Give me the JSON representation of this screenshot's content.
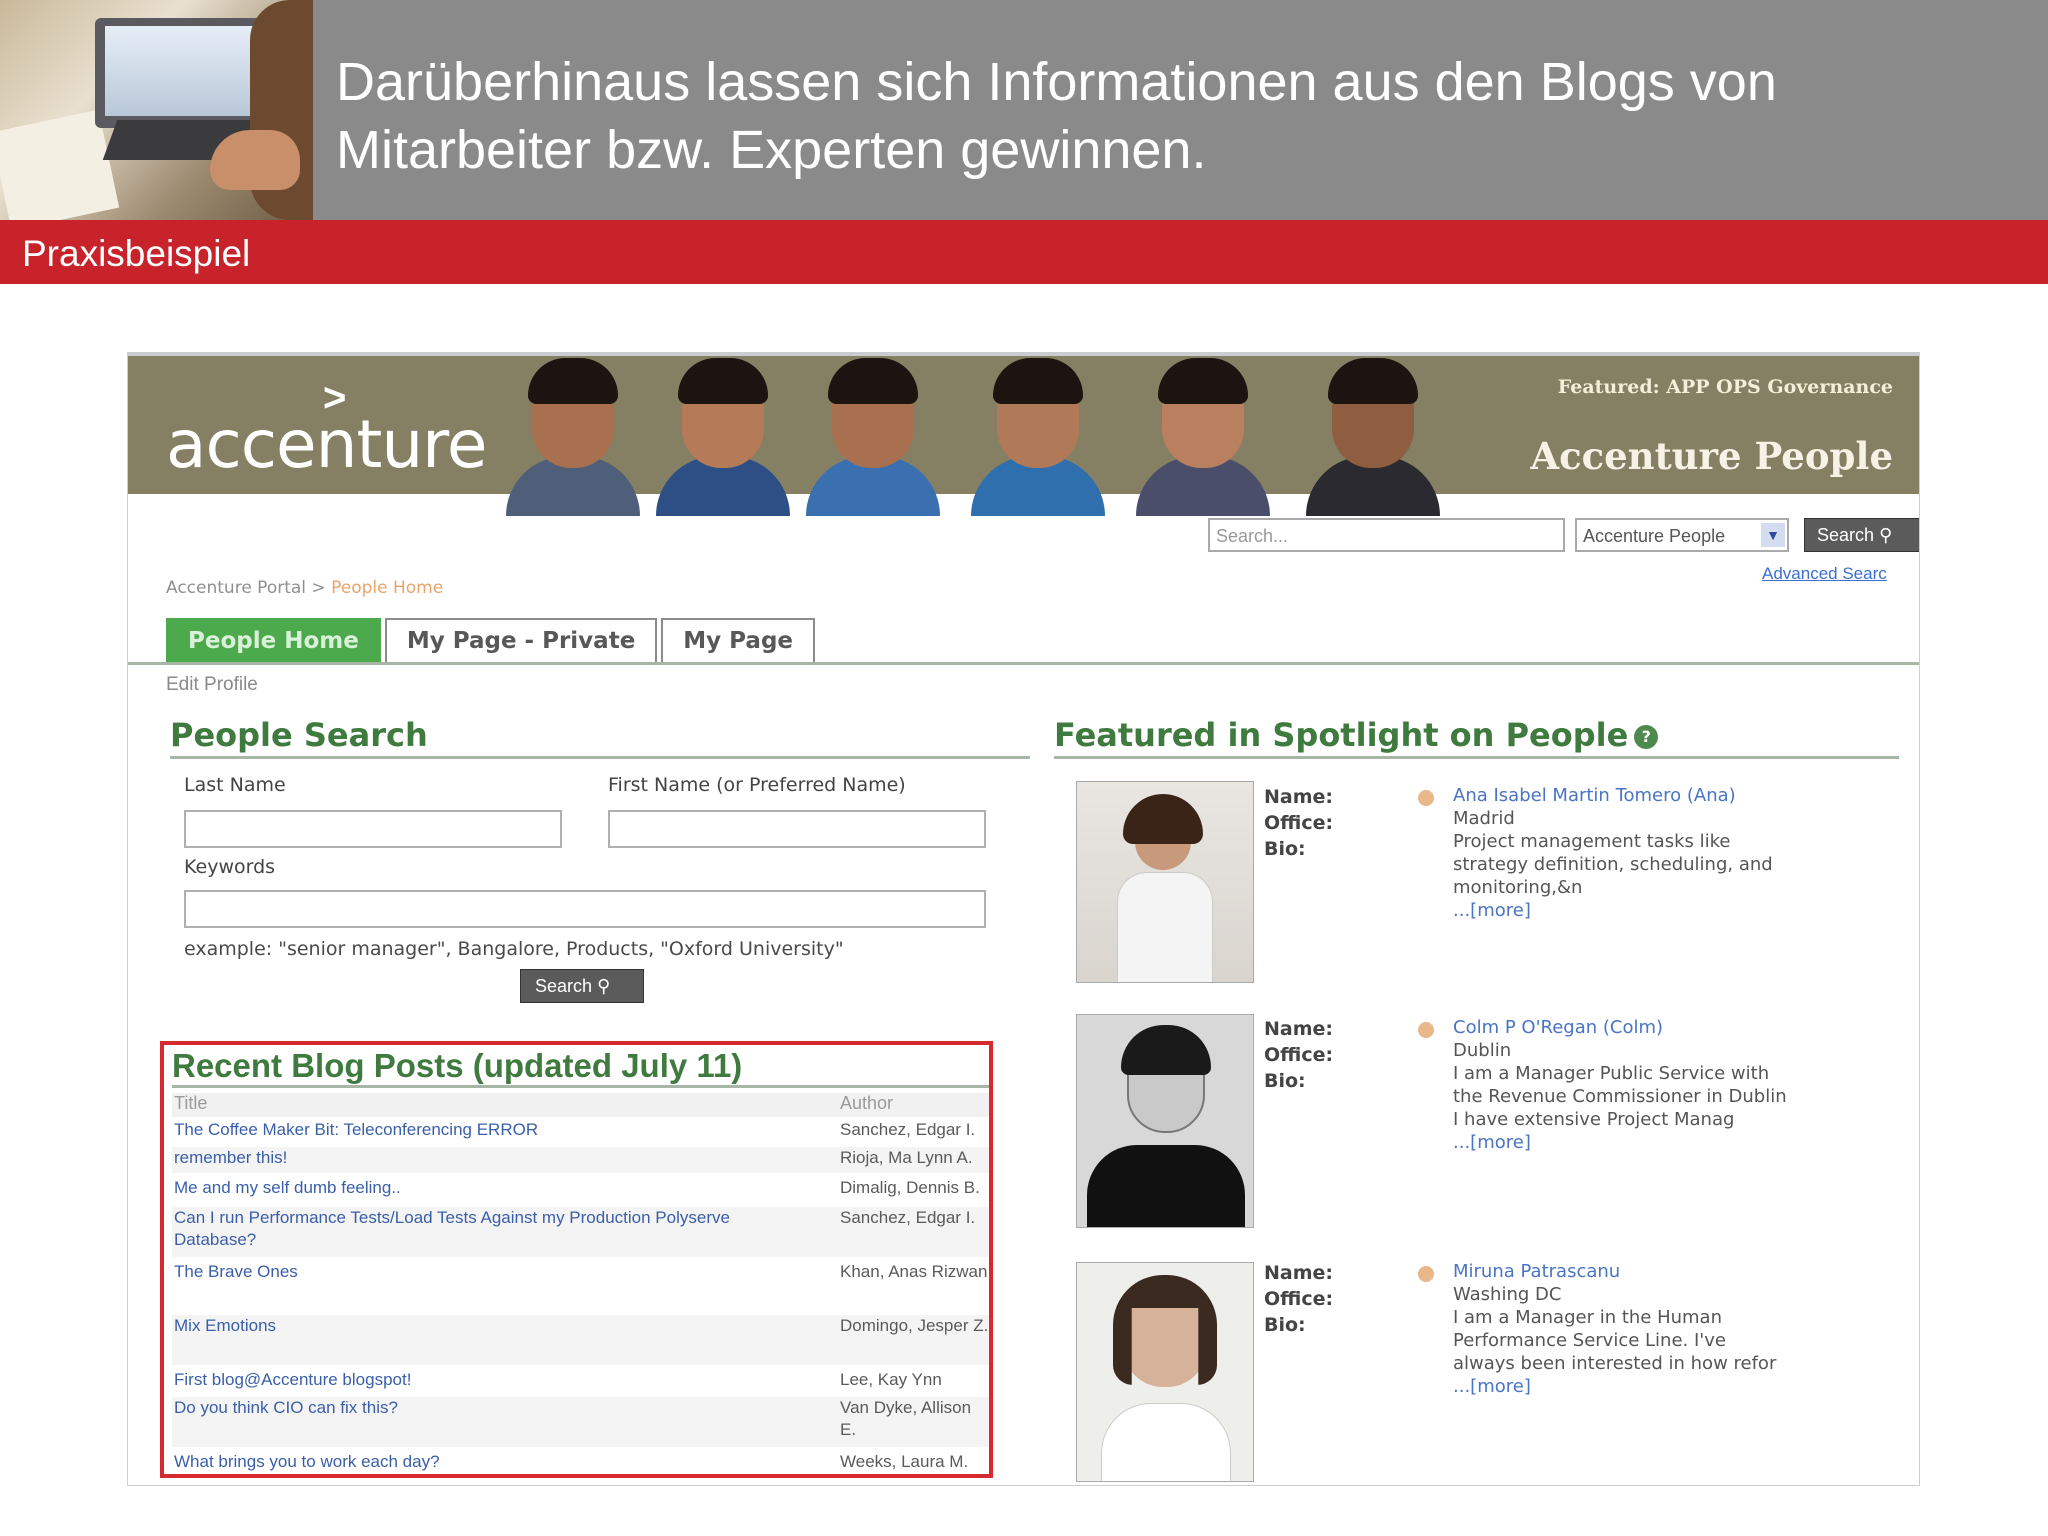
{
  "slide": {
    "title_line1": "Darüberhinaus lassen sich Informationen aus den Blogs von",
    "title_line2": "Mitarbeiter bzw. Experten gewinnen.",
    "section_label": "Praxisbeispiel"
  },
  "portal": {
    "logo_arrow": ">",
    "logo": "accenture",
    "featured_small": "Featured: APP OPS Governance",
    "featured_big": "Accenture People",
    "search_placeholder": "Search...",
    "scope_value": "Accenture People",
    "search_button": "Search",
    "advanced_link": "Advanced Searc",
    "breadcrumb_root": "Accenture Portal",
    "breadcrumb_sep": " > ",
    "breadcrumb_current": "People Home",
    "tabs": [
      "People Home",
      "My Page - Private",
      "My Page"
    ],
    "edit_profile": "Edit Profile"
  },
  "people_search": {
    "title": "People Search",
    "last_name_label": "Last Name",
    "first_name_label": "First Name (or Preferred Name)",
    "keywords_label": "Keywords",
    "example": "example: \"senior manager\", Bangalore, Products, \"Oxford University\"",
    "search_button": "Search"
  },
  "blog": {
    "title": "Recent Blog Posts (updated July 11)",
    "col_title": "Title",
    "col_author": "Author",
    "rows": [
      {
        "title": "The Coffee Maker Bit: Teleconferencing ERROR",
        "author": "Sanchez, Edgar I."
      },
      {
        "title": "remember this!",
        "author": "Rioja, Ma Lynn A."
      },
      {
        "title": "Me and my self dumb feeling..",
        "author": "Dimalig, Dennis B."
      },
      {
        "title": "Can I run Performance Tests/Load Tests Against my Production Polyserve Database?",
        "author": "Sanchez, Edgar I."
      },
      {
        "title": "The Brave Ones",
        "author": "Khan, Anas Rizwan"
      },
      {
        "title": "Mix Emotions",
        "author": "Domingo, Jesper Z."
      },
      {
        "title": "First blog@Accenture blogspot!",
        "author": "Lee, Kay Ynn"
      },
      {
        "title": "Do you think CIO can fix this?",
        "author": "Van Dyke, Allison E."
      },
      {
        "title": "What brings you to work each day?",
        "author": "Weeks, Laura M."
      }
    ]
  },
  "spotlight": {
    "title": "Featured in Spotlight on People",
    "label_name": "Name:",
    "label_office": "Office:",
    "label_bio": "Bio:",
    "people": [
      {
        "name": "Ana Isabel Martin Tomero (Ana)",
        "office": "Madrid",
        "bio": "Project management tasks like strategy definition, scheduling, and monitoring,&n",
        "more": "...[more]"
      },
      {
        "name": "Colm P O'Regan (Colm)",
        "office": "Dublin",
        "bio": "I am a Manager Public Service with the Revenue Commissioner in Dublin I have extensive Project Manag",
        "more": "...[more]"
      },
      {
        "name": "Miruna Patrascanu",
        "office": "Washing DC",
        "bio": "I am a Manager in the Human Performance Service Line. I've always been interested in how refor",
        "more": "...[more]"
      }
    ]
  },
  "colors": {
    "header_gray": "#8a8a8a",
    "accent_red": "#c8232b",
    "banner_olive": "#858063",
    "section_green": "#3f7a3f",
    "tab_green": "#4caa4c",
    "link_blue": "#3a5fa8",
    "highlight_red": "#d42a30"
  }
}
